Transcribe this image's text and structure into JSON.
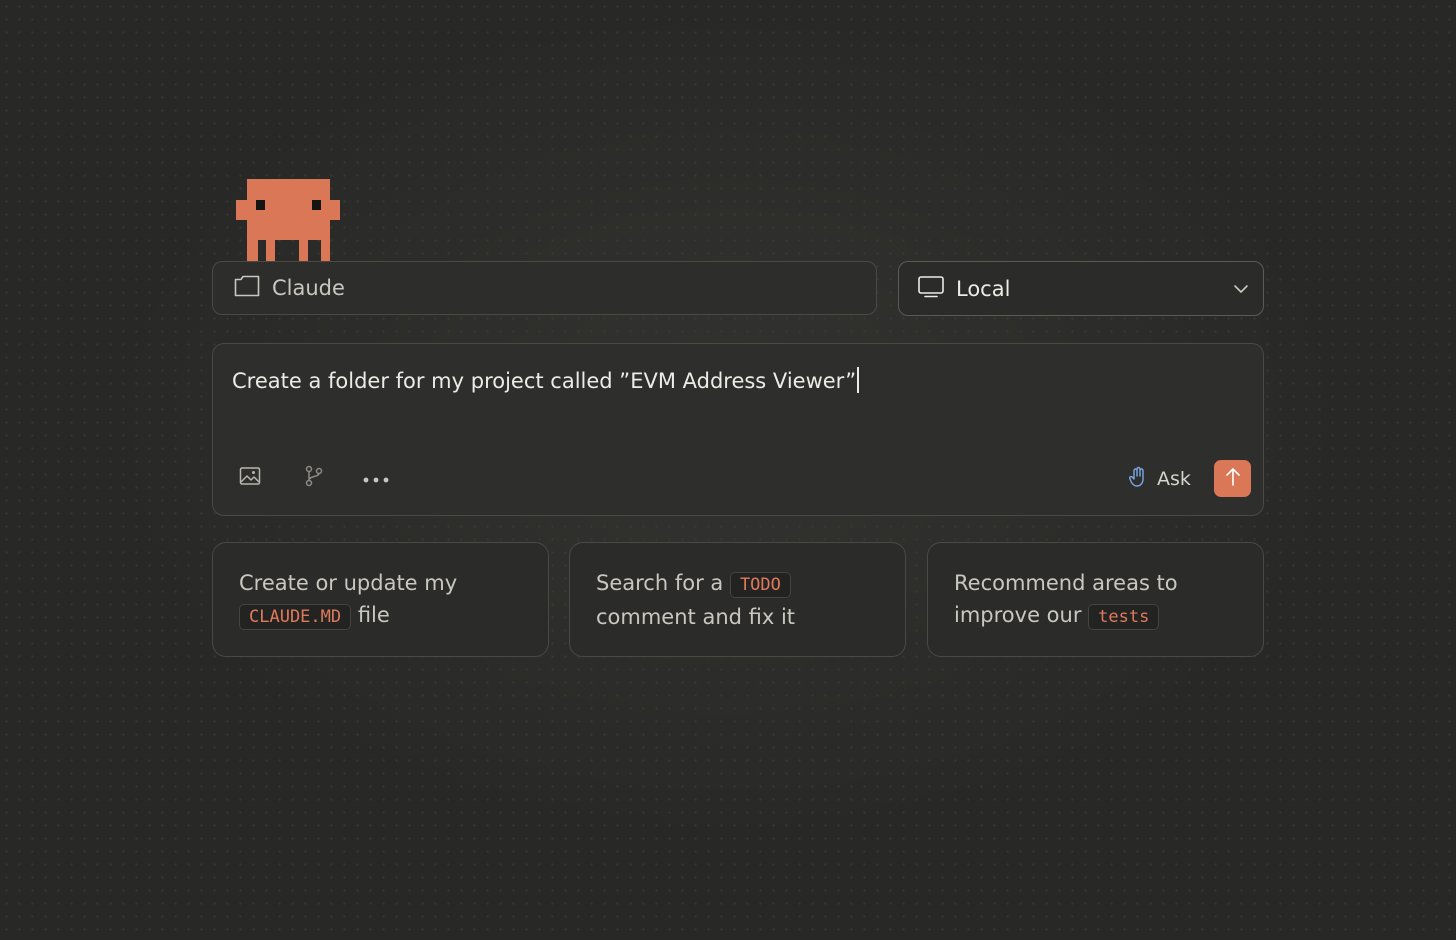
{
  "project": {
    "folder_label": "Claude",
    "folder_icon": "folder-icon"
  },
  "environment": {
    "selected": "Local",
    "icon": "monitor-icon"
  },
  "prompt": {
    "text": "Create a folder for my project called ”EVM Address Viewer”"
  },
  "toolbar": {
    "icons": [
      "image-icon",
      "branch-icon",
      "more-icon"
    ],
    "mode_label": "Ask",
    "mode_icon": "hand-icon",
    "send_icon": "arrow-up-icon"
  },
  "suggestions": [
    {
      "before": "Create or update my",
      "code": "CLAUDE.MD",
      "after": "file"
    },
    {
      "before": "Search for a",
      "code": "TODO",
      "after": "comment and fix it"
    },
    {
      "before": "Recommend areas to improve our",
      "code": "tests",
      "after": ""
    }
  ],
  "colors": {
    "accent": "#d97757",
    "background": "#282826",
    "code_text": "#e07a5f"
  }
}
